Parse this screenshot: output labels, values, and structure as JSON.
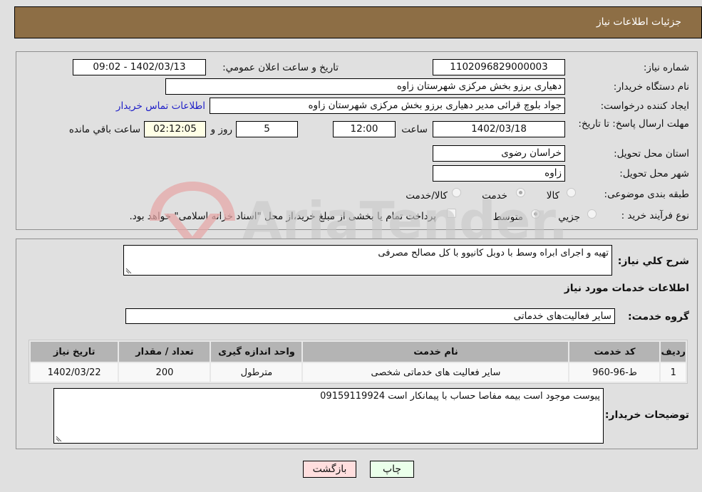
{
  "header": {
    "title": "جزئیات اطلاعات نیاز"
  },
  "fields": {
    "need_number_label": "شماره نیاز:",
    "need_number": "1102096829000003",
    "announce_label": "تاریخ و ساعت اعلان عمومي:",
    "announce_value": "1402/03/13 - 09:02",
    "buyer_org_label": "نام دستگاه خریدار:",
    "buyer_org": "دهیاری برزو بخش مرکزی شهرستان زاوه",
    "creator_label": "ایجاد کننده درخواست:",
    "creator": "جواد بلوچ قرائی مدیر دهیاری برزو بخش مرکزی شهرستان زاوه",
    "contact_link": "اطلاعات تماس خریدار",
    "deadline_label": "مهلت ارسال پاسخ: تا تاریخ:",
    "deadline_date": "1402/03/18",
    "time_label": "ساعت",
    "deadline_time": "12:00",
    "days_value": "5",
    "days_label": "روز و",
    "remaining_time": "02:12:05",
    "remaining_label": "ساعت باقي مانده",
    "province_label": "استان محل تحویل:",
    "province": "خراسان رضوی",
    "city_label": "شهر محل تحویل:",
    "city": "زاوه",
    "category_label": "طبقه بندی موضوعی:",
    "category_options": [
      {
        "label": "کالا",
        "checked": false
      },
      {
        "label": "خدمت",
        "checked": true
      },
      {
        "label": "کالا/خدمت",
        "checked": false
      }
    ],
    "process_label": "نوع فرآیند خرید :",
    "process_options": [
      {
        "label": "جزيي",
        "checked": false
      },
      {
        "label": "متوسط",
        "checked": true
      }
    ],
    "payment_note": "پرداخت تمام یا بخشی از مبلغ خرید،از محل \"اسناد خزانه اسلامی\" خواهد بود."
  },
  "details": {
    "summary_label": "شرح کلي نياز:",
    "summary": "تهیه و اجرای ابراه وسط با دوبل کانیوو با کل مصالح مصرفی",
    "services_title": "اطلاعات خدمات مورد نیاز",
    "service_group_label": "گروه خدمت:",
    "service_group": "سایر فعالیت‌های خدماتی",
    "table": {
      "headers": [
        "ردیف",
        "کد خدمت",
        "نام خدمت",
        "واحد اندازه گیری",
        "تعداد / مقدار",
        "تاریخ نیاز"
      ],
      "rows": [
        [
          "1",
          "ط-96-960",
          "سایر فعالیت های خدماتی شخصی",
          "مترطول",
          "200",
          "1402/03/22"
        ]
      ]
    },
    "buyer_notes_label": "توضیحات خریدار:",
    "buyer_notes": "پیوست موجود است بیمه مفاصا حساب با پیمانکار است 09159119924"
  },
  "buttons": {
    "print": "چاپ",
    "back": "بازگشت"
  },
  "watermark": {
    "text": "AriaTender.neT"
  },
  "colors": {
    "header_bg": "#8d6e45",
    "print_bg": "#eaffea",
    "back_bg": "#ffdede",
    "link": "#2020c8"
  }
}
